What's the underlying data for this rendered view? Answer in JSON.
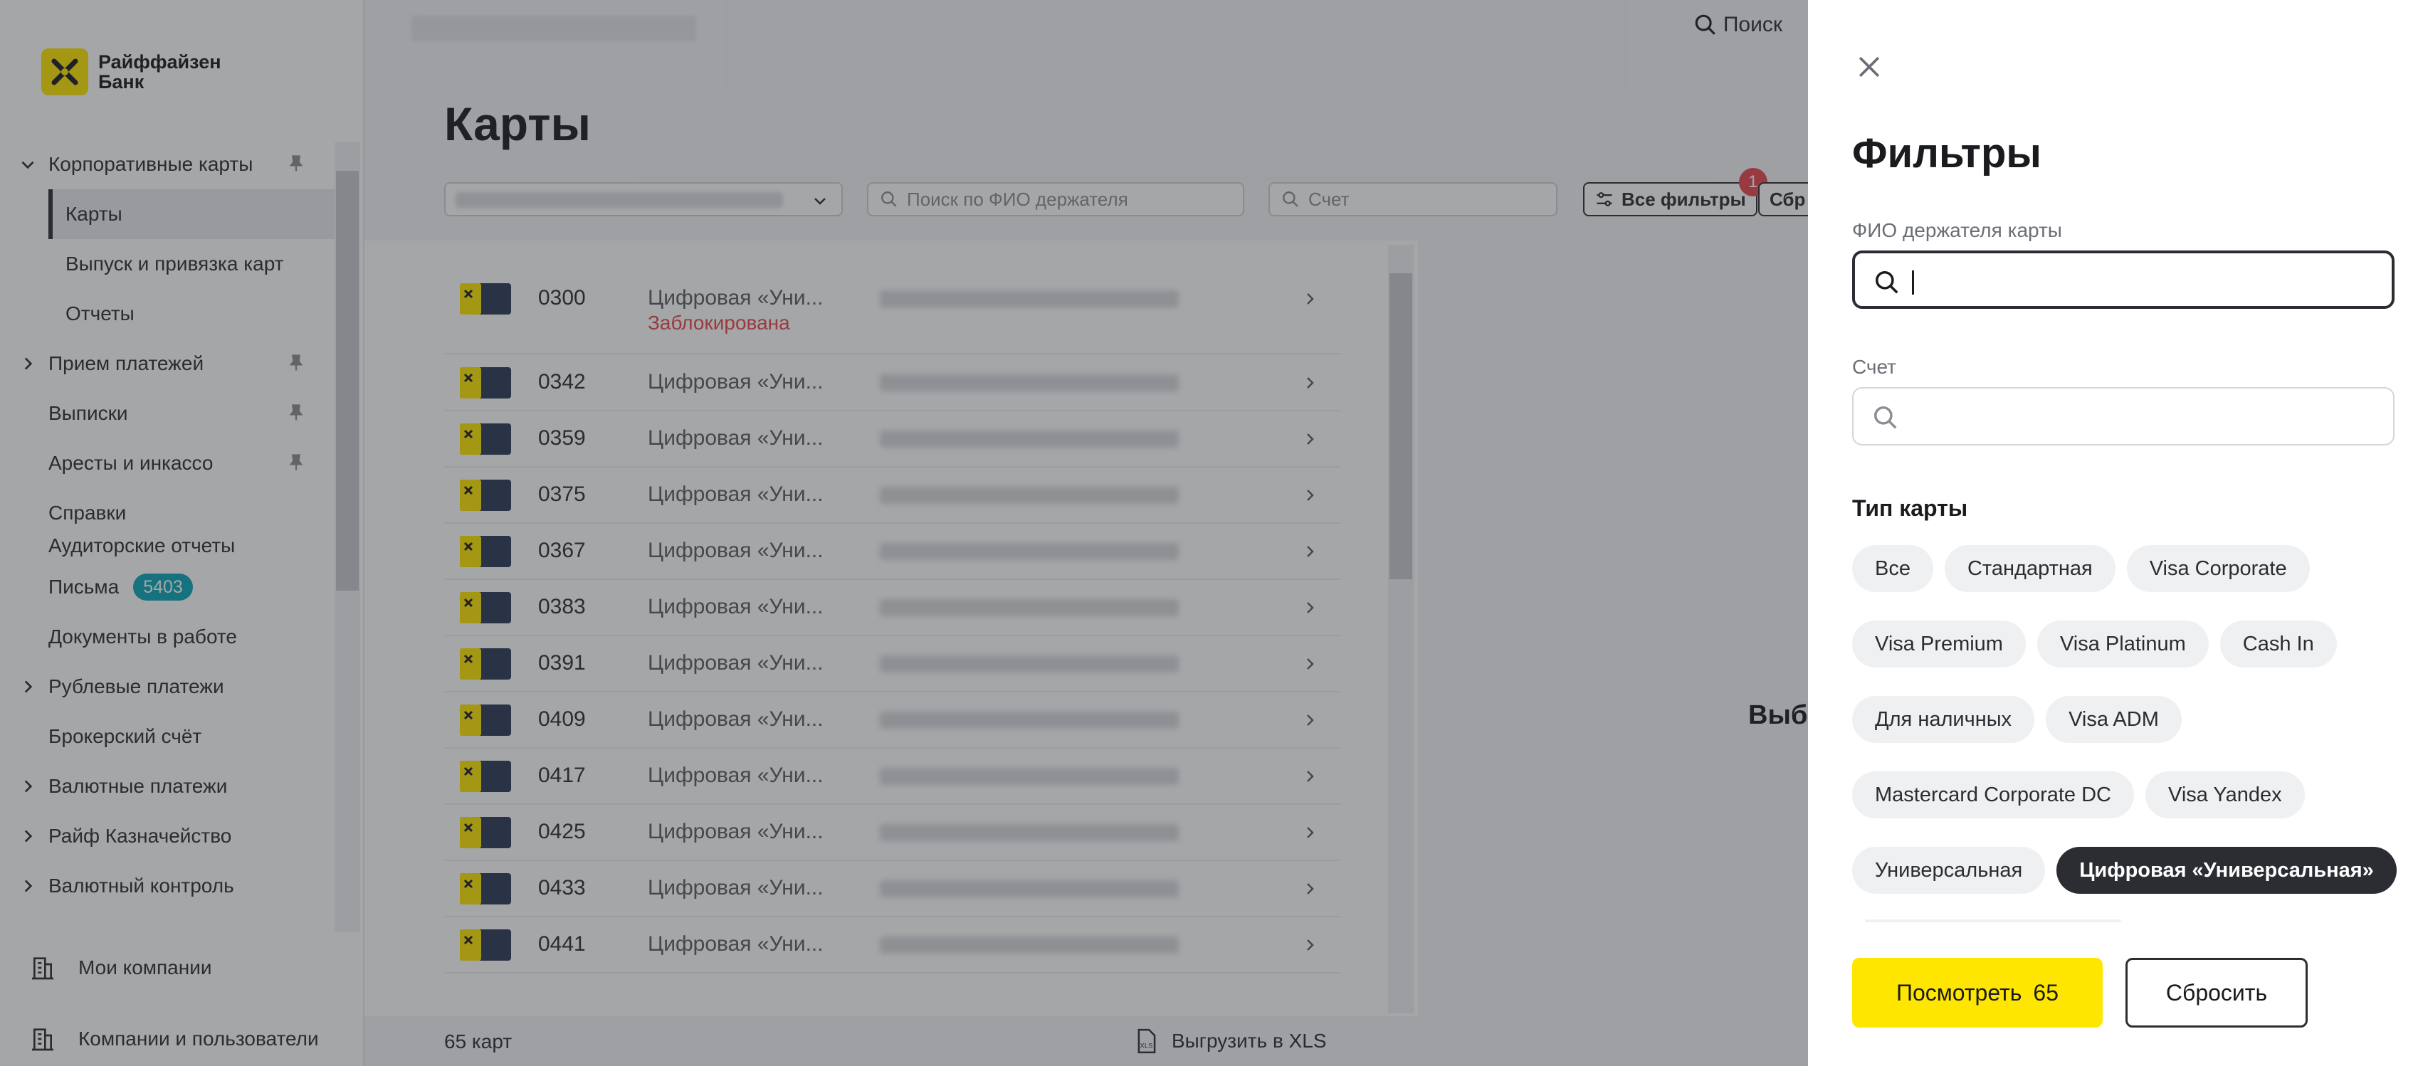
{
  "brand": {
    "name_line1": "Райффайзен",
    "name_line2": "Банк",
    "accent": "#fee600"
  },
  "sidebar": {
    "items": [
      {
        "label": "Корпоративные карты",
        "expanded": true,
        "pinned": true
      },
      {
        "label": "Карты",
        "sub": true,
        "active": true
      },
      {
        "label": "Выпуск и привязка карт",
        "sub": true
      },
      {
        "label": "Отчеты",
        "sub": true
      },
      {
        "label": "Прием платежей",
        "chevron": true,
        "pinned": true
      },
      {
        "label": "Выписки",
        "pinned": true
      },
      {
        "label": "Аресты и инкассо",
        "pinned": true
      },
      {
        "label": "Справки"
      },
      {
        "label": "Аудиторские отчеты"
      },
      {
        "label": "Письма",
        "badge": "5403"
      },
      {
        "label": "Документы в работе"
      },
      {
        "label": "Рублевые платежи",
        "chevron": true
      },
      {
        "label": "Брокерский счёт"
      },
      {
        "label": "Валютные платежи",
        "chevron": true
      },
      {
        "label": "Райф Казначейство",
        "chevron": true
      },
      {
        "label": "Валютный контроль",
        "chevron": true
      }
    ],
    "bottom": {
      "companies": "Мои компании",
      "users": "Компании и пользователи"
    }
  },
  "topbar": {
    "search_label": "Поиск"
  },
  "page": {
    "title": "Карты",
    "holder_search_placeholder": "Поиск по ФИО держателя",
    "account_placeholder": "Счет",
    "all_filters_label": "Все фильтры",
    "all_filters_count": "1",
    "reset_label_partial": "Сбр",
    "right_pane_text": "Выбе"
  },
  "cards": [
    {
      "number": "0300",
      "name": "Цифровая «Уни...",
      "status": "Заблокирована"
    },
    {
      "number": "0342",
      "name": "Цифровая «Уни..."
    },
    {
      "number": "0359",
      "name": "Цифровая «Уни..."
    },
    {
      "number": "0375",
      "name": "Цифровая «Уни..."
    },
    {
      "number": "0367",
      "name": "Цифровая «Уни..."
    },
    {
      "number": "0383",
      "name": "Цифровая «Уни..."
    },
    {
      "number": "0391",
      "name": "Цифровая «Уни..."
    },
    {
      "number": "0409",
      "name": "Цифровая «Уни..."
    },
    {
      "number": "0417",
      "name": "Цифровая «Уни..."
    },
    {
      "number": "0425",
      "name": "Цифровая «Уни..."
    },
    {
      "number": "0433",
      "name": "Цифровая «Уни..."
    },
    {
      "number": "0441",
      "name": "Цифровая «Уни..."
    }
  ],
  "footer": {
    "count": "65 карт",
    "export": "Выгрузить в XLS"
  },
  "drawer": {
    "title": "Фильтры",
    "holder_label": "ФИО держателя карты",
    "holder_value": "",
    "account_label": "Счет",
    "account_value": "",
    "card_type_title": "Тип карты",
    "chips": [
      [
        "Все",
        "Стандартная",
        "Visa Corporate"
      ],
      [
        "Visa Premium",
        "Visa Platinum",
        "Cash In"
      ],
      [
        "Для наличных",
        "Visa ADM"
      ],
      [
        "Mastercard Corporate DC",
        "Visa Yandex"
      ],
      [
        "Универсальная",
        "Цифровая «Универсальная»"
      ]
    ],
    "selected_chip": "Цифровая «Универсальная»",
    "view_label": "Посмотреть",
    "view_count": "65",
    "reset_label": "Сбросить"
  }
}
